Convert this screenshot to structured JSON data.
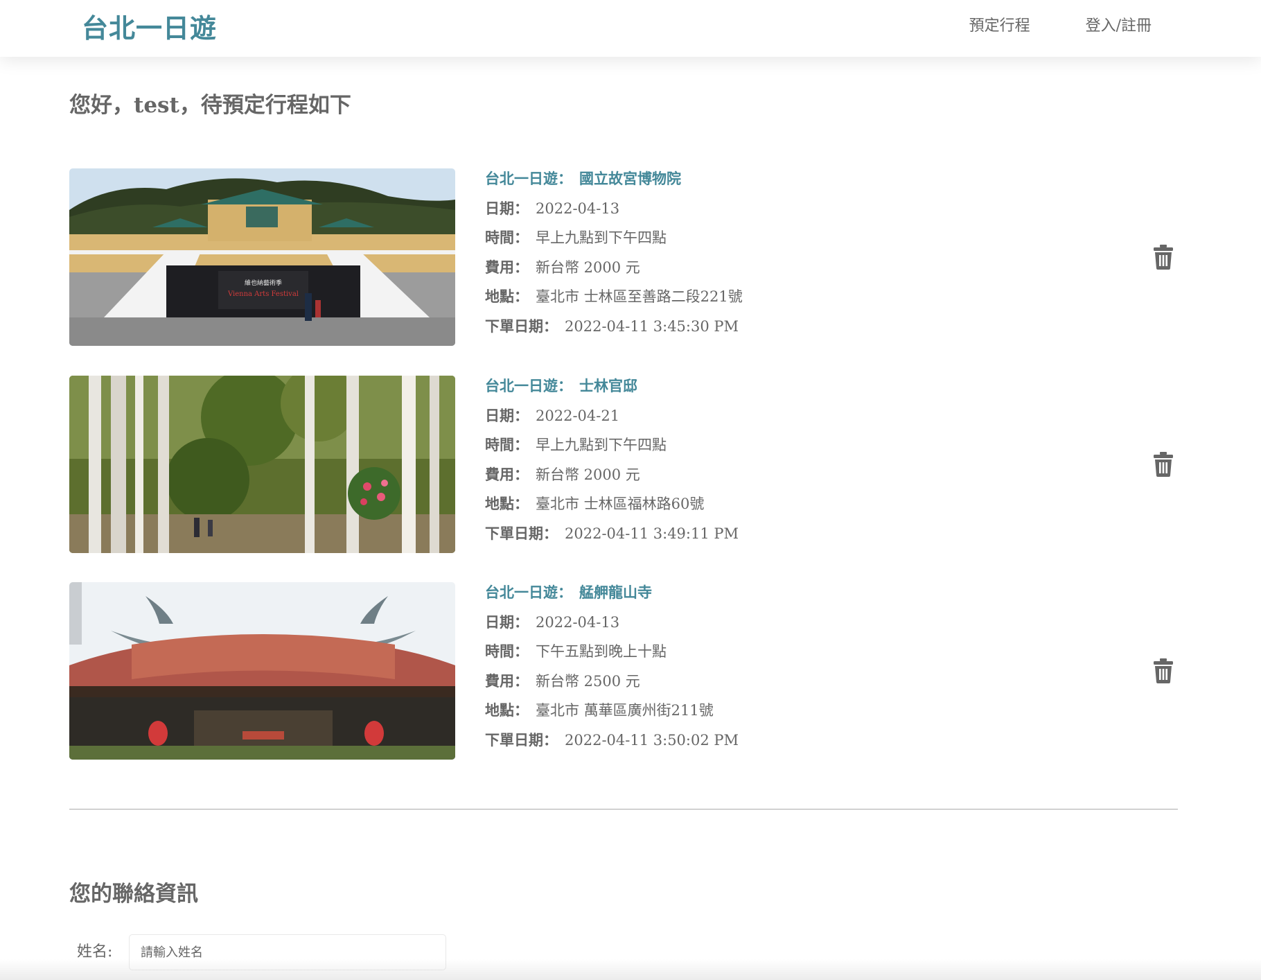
{
  "navbar": {
    "brand": "台北一日遊",
    "links": [
      "預定行程",
      "登入/註冊"
    ]
  },
  "greeting": {
    "prefix": "您好，",
    "username": "test",
    "suffix": "，待預定行程如下"
  },
  "labels": {
    "title_prefix": "台北一日遊：",
    "date": "日期：",
    "time": "時間：",
    "price": "費用：",
    "address": "地點：",
    "order_date": "下單日期："
  },
  "bookings": [
    {
      "attraction": "國立故宮博物院",
      "date": "2022-04-13",
      "time": "早上九點到下午四點",
      "price": "新台幣 2000 元",
      "address": "臺北市 士林區至善路二段221號",
      "order_date": "2022-04-11 3:45:30 PM",
      "image": "museum-photo"
    },
    {
      "attraction": "士林官邸",
      "date": "2022-04-21",
      "time": "早上九點到下午四點",
      "price": "新台幣 2000 元",
      "address": "臺北市 士林區福林路60號",
      "order_date": "2022-04-11 3:49:11 PM",
      "image": "palm-garden-photo"
    },
    {
      "attraction": "艋舺龍山寺",
      "date": "2022-04-13",
      "time": "下午五點到晚上十點",
      "price": "新台幣 2500 元",
      "address": "臺北市 萬華區廣州街211號",
      "order_date": "2022-04-11 3:50:02 PM",
      "image": "temple-photo"
    }
  ],
  "contact": {
    "title": "您的聯絡資訊",
    "name_label": "姓名:",
    "name_placeholder": "請輸入姓名"
  },
  "icons": {
    "delete": "trash-icon"
  },
  "colors": {
    "brand": "#448899",
    "text": "#666666",
    "divider": "#aaaaaa"
  }
}
